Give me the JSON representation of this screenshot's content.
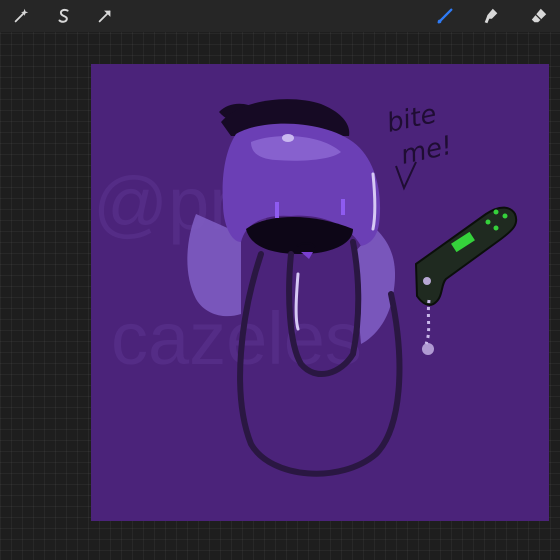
{
  "toolbar": {
    "left_tools": [
      {
        "icon": "magic-wand-icon"
      },
      {
        "icon": "selection-icon"
      },
      {
        "icon": "transform-arrow-icon"
      }
    ],
    "right_tools": [
      {
        "icon": "brush-icon",
        "active": true
      },
      {
        "icon": "smudge-icon"
      },
      {
        "icon": "eraser-icon"
      }
    ],
    "active_color": "#2f7bf5",
    "icon_color": "#d8d8d8"
  },
  "canvas": {
    "background_color": "#4b237a",
    "watermark_line1": "@pm-",
    "watermark_line2": "cazeles",
    "caption": "bite me!",
    "caption_line1": "bite",
    "caption_line2": "me!"
  }
}
